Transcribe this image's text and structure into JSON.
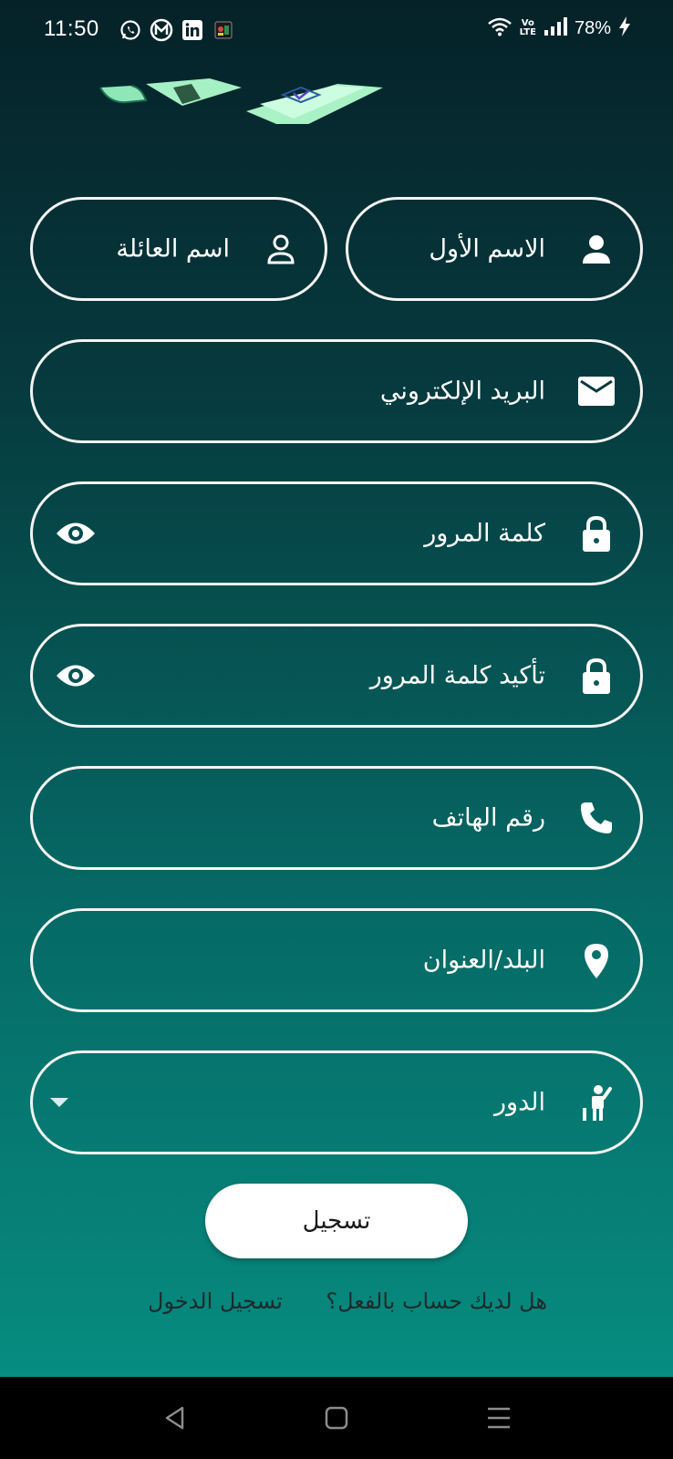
{
  "status": {
    "time": "11:50",
    "battery": "78%",
    "volte_top": "Vo",
    "volte_bottom": "LTE",
    "apps": [
      "whatsapp-icon",
      "m-app-icon",
      "linkedin-icon",
      "app-icon"
    ]
  },
  "form": {
    "first_name": "الاسم الأول",
    "last_name": "اسم العائلة",
    "email": "البريد الإلكتروني",
    "password": "كلمة المرور",
    "confirm_password": "تأكيد كلمة المرور",
    "phone": "رقم الهاتف",
    "address": "البلد/العنوان",
    "role": "الدور"
  },
  "actions": {
    "register": "تسجيل",
    "have_account": "هل لديك حساب بالفعل؟",
    "login": "تسجيل الدخول"
  },
  "colors": {
    "gradient_top": "#052228",
    "gradient_bottom": "#078c80",
    "field_border": "#f4f4f4",
    "button_bg": "#ffffff"
  }
}
